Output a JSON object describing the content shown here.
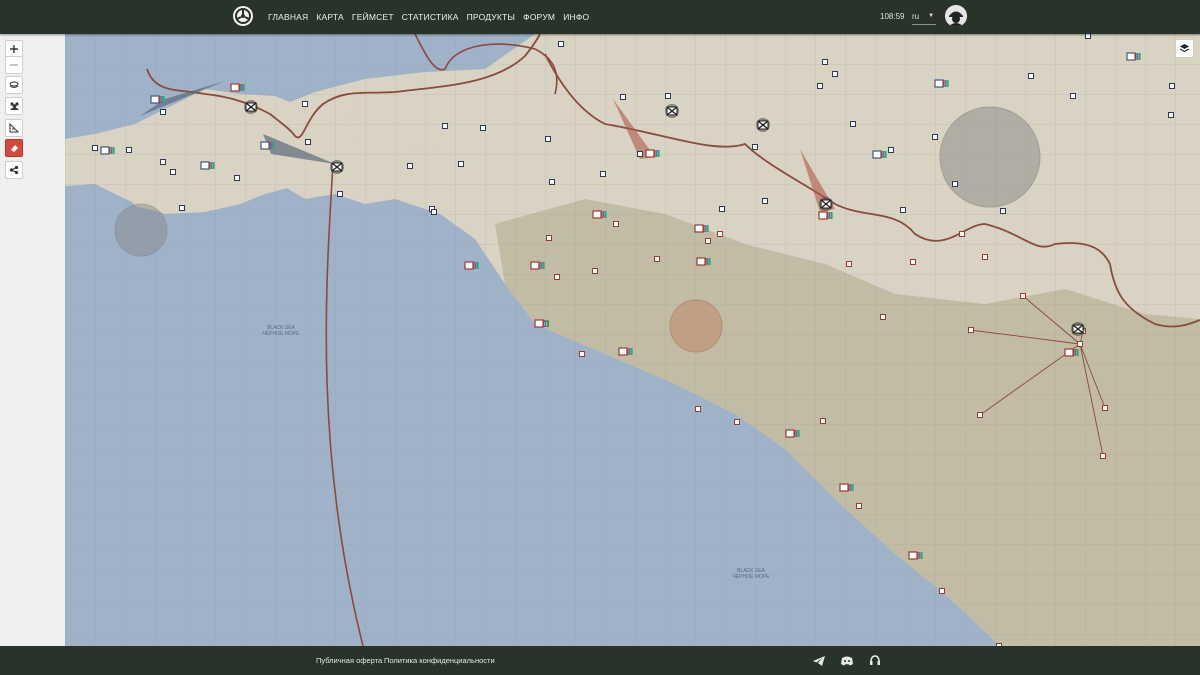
{
  "header": {
    "logo_icon": "steering-wheel-logo-icon",
    "nav": [
      "ГЛАВНАЯ",
      "КАРТА",
      "ГЕЙМСЕТ",
      "СТАТИСТИКА",
      "ПРОДУКТЫ",
      "ФОРУМ",
      "ИНФО"
    ],
    "clock": "108:59",
    "language": "ru",
    "avatar_icon": "soldier-avatar-icon"
  },
  "map_tools": [
    "zoom-in-icon",
    "zoom-out-icon",
    "layers-stack-icon",
    "group-icon",
    "ruler-icon",
    "eraser-icon",
    "share-icon"
  ],
  "map": {
    "sea_labels": [
      {
        "line1": "BLACK SEA",
        "line2": "ЧЁРНОЕ МОРЕ"
      },
      {
        "line1": "BLACK SEA",
        "line2": "ЧЁРНОЕ МОРЕ"
      }
    ],
    "colors": {
      "sea": "#9fb2c7",
      "land": "#d8d3c2",
      "hills": "#bdb79d",
      "front": "#8a4a3c",
      "grid": "#7f8fa3"
    }
  },
  "footer": {
    "offer": "Публичная оферта",
    "privacy": "Политика конфиденциальности",
    "icons": [
      "telegram-icon",
      "discord-icon",
      "support-headset-icon"
    ]
  }
}
